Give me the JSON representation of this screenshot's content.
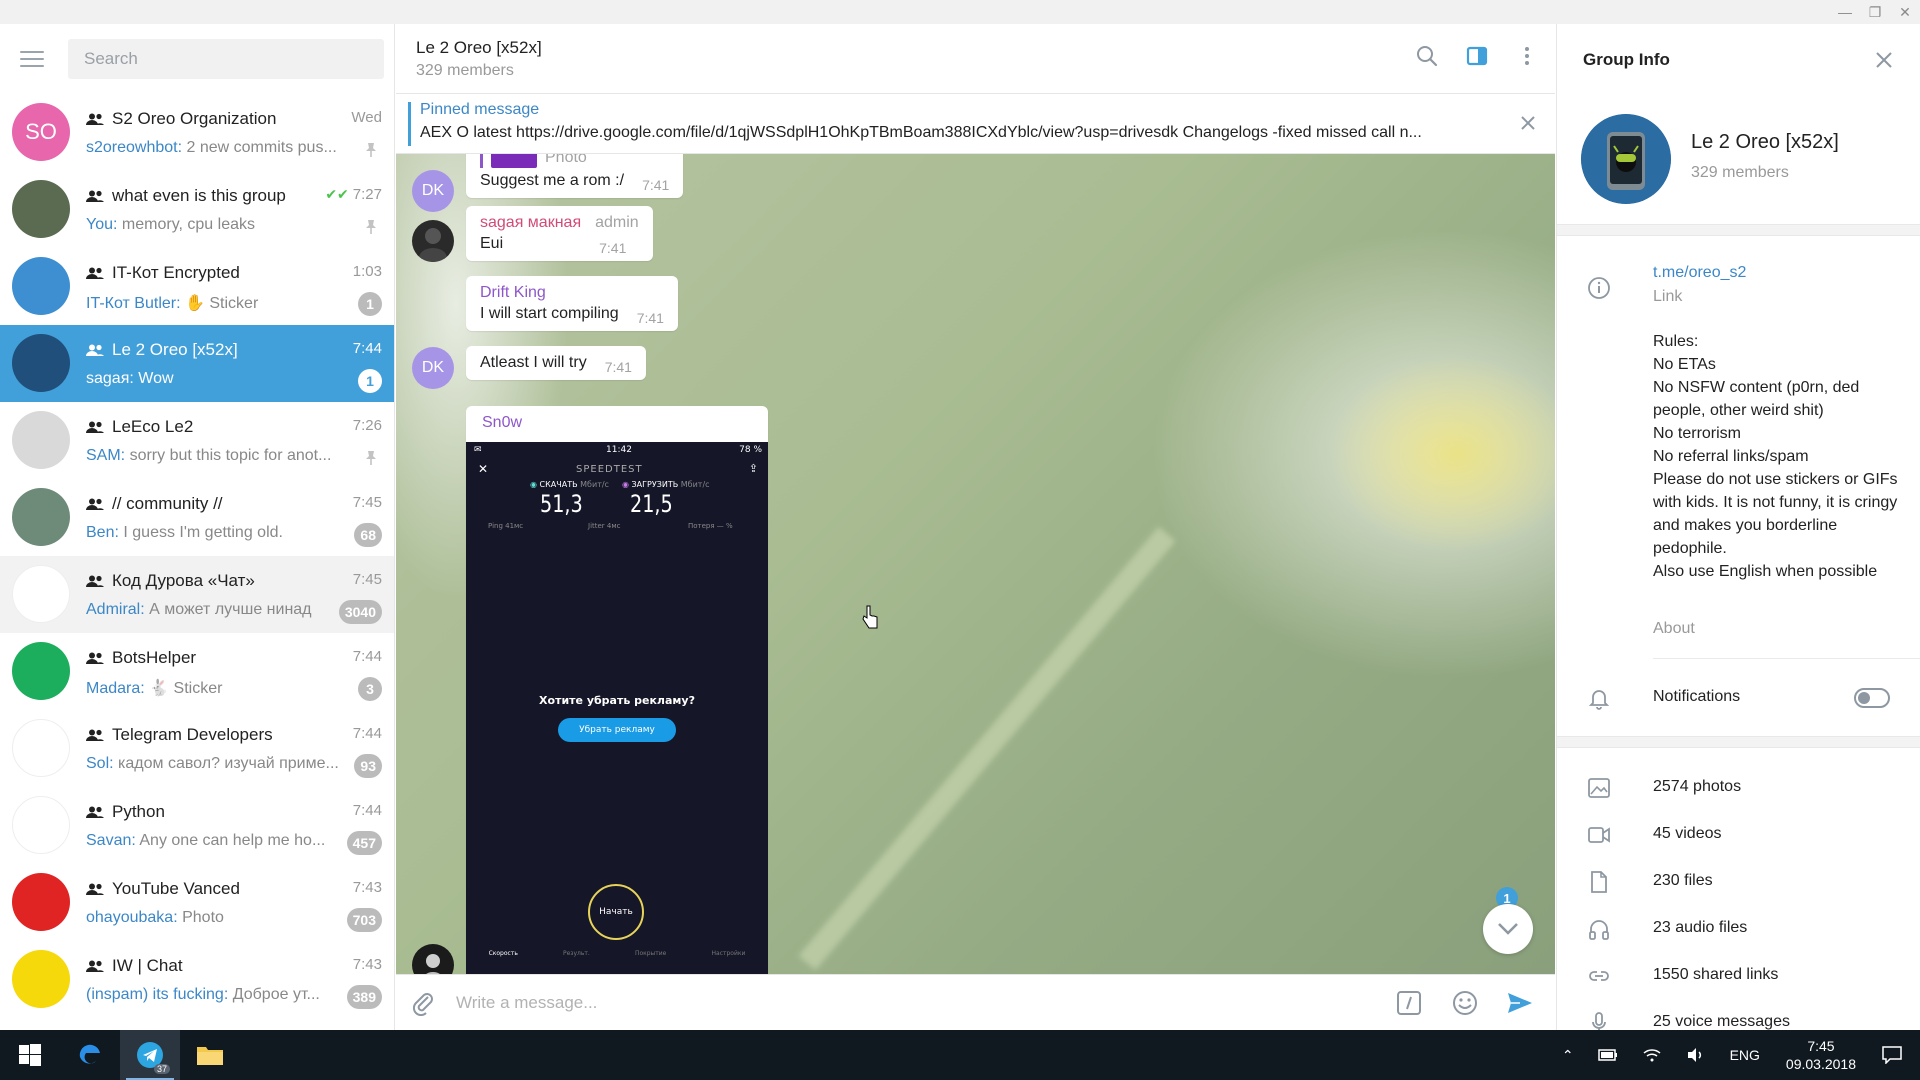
{
  "window": {
    "controls": [
      "—",
      "❐",
      "✕"
    ]
  },
  "sidebar": {
    "search_placeholder": "Search",
    "chats": [
      {
        "avatar": "SO",
        "avatar_color": "#e766ac",
        "name": "S2 Oreo Organization",
        "time": "Wed",
        "sender": "s2oreowhbot:",
        "preview": "2 new commits pus...",
        "badge": "",
        "pinned": true,
        "read": false,
        "state": ""
      },
      {
        "avatar": "",
        "avatar_color": "#5a6b52",
        "name": "what even is this group",
        "time": "7:27",
        "sender": "You:",
        "preview": "memory, cpu leaks",
        "badge": "",
        "pinned": true,
        "read": true,
        "state": ""
      },
      {
        "avatar": "",
        "avatar_color": "#3e8fd1",
        "name": "IT-Кот Encrypted",
        "time": "1:03",
        "sender": "IT-Кот Butler:",
        "preview": "✋ Sticker",
        "badge": "1",
        "pinned": false,
        "read": false,
        "state": ""
      },
      {
        "avatar": "",
        "avatar_color": "#1f4f7a",
        "name": "Le 2 Oreo [x52x]",
        "time": "7:44",
        "sender": "sagaя:",
        "preview": "Wow",
        "badge": "1",
        "pinned": false,
        "read": false,
        "state": "active"
      },
      {
        "avatar": "",
        "avatar_color": "#d9d9d9",
        "name": "LeEco Le2",
        "time": "7:26",
        "sender": "SAM:",
        "preview": "sorry but this topic for anot...",
        "badge": "",
        "pinned": true,
        "read": false,
        "state": ""
      },
      {
        "avatar": "",
        "avatar_color": "#6e8b7a",
        "name": "// community //",
        "time": "7:45",
        "sender": "Ben:",
        "preview": "I guess I'm getting old.",
        "badge": "68",
        "pinned": false,
        "read": false,
        "state": ""
      },
      {
        "avatar": "",
        "avatar_color": "#ffffff",
        "name": "Код Дурова «Чат»",
        "time": "7:45",
        "sender": "Admiral:",
        "preview": "А может лучше нинад",
        "badge": "3040",
        "pinned": false,
        "read": false,
        "state": "hover"
      },
      {
        "avatar": "",
        "avatar_color": "#1cae5c",
        "name": "BotsHelper",
        "time": "7:44",
        "sender": "Madara:",
        "preview": "🐇 Sticker",
        "badge": "3",
        "pinned": false,
        "read": false,
        "state": ""
      },
      {
        "avatar": "",
        "avatar_color": "#ffffff",
        "name": "Telegram Developers",
        "time": "7:44",
        "sender": "Sol:",
        "preview": "кадом савол? изучай приме...",
        "badge": "93",
        "pinned": false,
        "read": false,
        "state": ""
      },
      {
        "avatar": "",
        "avatar_color": "#ffffff",
        "name": "Python",
        "time": "7:44",
        "sender": "Savan:",
        "preview": "Any one can help me ho...",
        "badge": "457",
        "pinned": false,
        "read": false,
        "state": ""
      },
      {
        "avatar": "",
        "avatar_color": "#e02424",
        "name": "YouTube Vanced",
        "time": "7:43",
        "sender": "ohayoubaka:",
        "preview": "Photo",
        "badge": "703",
        "pinned": false,
        "read": false,
        "state": ""
      },
      {
        "avatar": "",
        "avatar_color": "#f5d90a",
        "name": "IW | Chat",
        "time": "7:43",
        "sender": "(inspam) its fucking:",
        "preview": "Доброе ут...",
        "badge": "389",
        "pinned": false,
        "read": false,
        "state": ""
      }
    ]
  },
  "chat": {
    "title": "Le 2 Oreo [x52x]",
    "members": "329 members",
    "pinned_label": "Pinned message",
    "pinned_text": "AEX O latest   https://drive.google.com/file/d/1qjWSSdplH1OhKpTBmBoam388ICXdYblc/view?usp=drivesdk   Changelogs  -fixed missed call n...",
    "messages": [
      {
        "avatar": "DK",
        "reply_label": "Photo",
        "text": "Suggest me a rom :/",
        "time": "7:41"
      },
      {
        "author": "sagaя макная",
        "role": "admin",
        "author_color": "#d14b77",
        "text": "Eui",
        "time": "7:41"
      },
      {
        "author": "Drift King",
        "author_color": "#8e57c9",
        "text": "I will start compiling",
        "time": "7:41"
      },
      {
        "avatar": "DK",
        "text": "Atleast I will try",
        "time": "7:41"
      }
    ],
    "photo_message": {
      "author": "Sn0w",
      "phone": {
        "clock": "11:42",
        "battery": "78 %",
        "app": "SPEEDTEST",
        "download_label": "СКАЧАТЬ",
        "download_unit": "Мбит/с",
        "upload_label": "ЗАГРУЗИТЬ",
        "upload_unit": "Мбит/с",
        "download": "51,3",
        "upload": "21,5",
        "ping": "Ping  41мс",
        "jitter": "Jitter  4мс",
        "loss": "Потеря  — %",
        "ad_question": "Хотите убрать рекламу?",
        "ad_button": "Убрать рекламу",
        "start": "Начать",
        "nav": [
          "Скорость",
          "Результ.",
          "Покрытие",
          "Настройки"
        ]
      }
    },
    "scroll_badge": "1",
    "composer_placeholder": "Write a message..."
  },
  "info": {
    "title": "Group Info",
    "name": "Le 2 Oreo [x52x]",
    "members": "329 members",
    "link": "t.me/oreo_s2",
    "link_label": "Link",
    "rules": [
      "Rules:",
      "No ETAs",
      "No NSFW content (p0rn, ded people, other weird shit)",
      "No terrorism",
      "No referral links/spam",
      "Please do not use stickers or GIFs with kids. It is not funny, it is cringy and makes you borderline pedophile.",
      "Also use English when possible"
    ],
    "about_label": "About",
    "notifications_label": "Notifications",
    "media": [
      {
        "icon": "photo-icon",
        "label": "2574 photos"
      },
      {
        "icon": "video-icon",
        "label": "45 videos"
      },
      {
        "icon": "file-icon",
        "label": "230 files"
      },
      {
        "icon": "headphones-icon",
        "label": "23 audio files"
      },
      {
        "icon": "link-icon",
        "label": "1550 shared links"
      },
      {
        "icon": "microphone-icon",
        "label": "25 voice messages"
      }
    ]
  },
  "taskbar": {
    "telegram_badge": "37",
    "language": "ENG",
    "time": "7:45",
    "date": "09.03.2018"
  }
}
